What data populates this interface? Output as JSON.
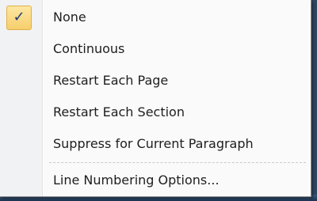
{
  "menu": {
    "items": [
      {
        "label": "None",
        "checked": true
      },
      {
        "label": "Continuous",
        "checked": false
      },
      {
        "label": "Restart Each Page",
        "checked": false
      },
      {
        "label": "Restart Each Section",
        "checked": false
      },
      {
        "label": "Suppress for Current Paragraph",
        "checked": false
      }
    ],
    "options_item": {
      "label": "Line Numbering Options..."
    },
    "check_glyph": "✓"
  },
  "colors": {
    "menu_background": "#fafafa",
    "gutter_background": "#f1f2f4",
    "checked_highlight": "#f6ce6c",
    "check_color": "#1c3a6e",
    "text_color": "#1e1e1e"
  }
}
